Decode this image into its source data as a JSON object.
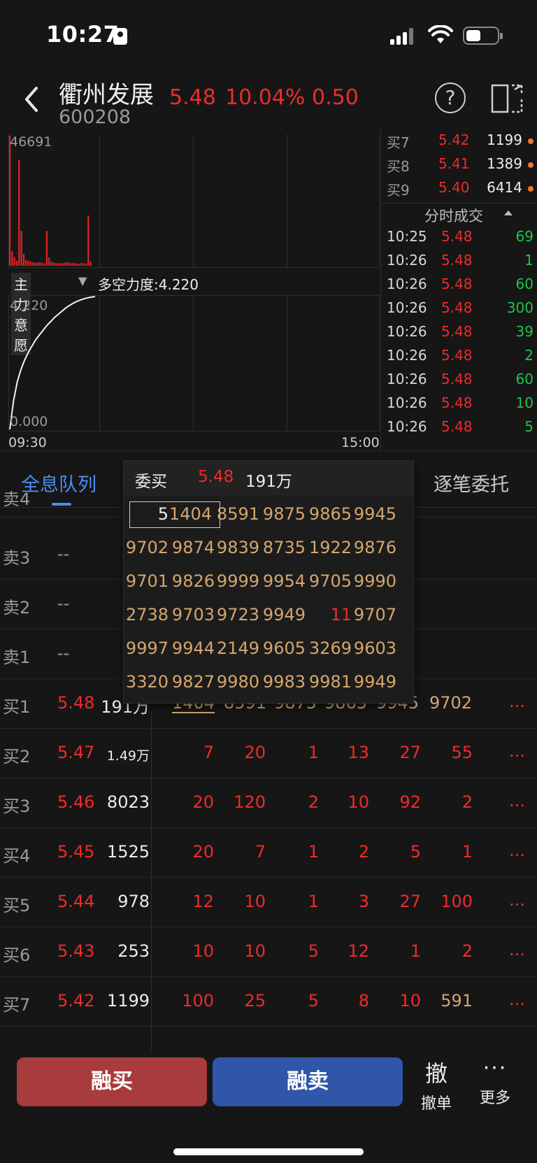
{
  "status_bar": {
    "time": "10:27"
  },
  "header": {
    "stock_name": "衢州发展",
    "stock_code": "600208",
    "price": "5.48",
    "change_pct": "10.04%",
    "change": "0.50",
    "help_glyph": "?"
  },
  "charts": {
    "volume_max": "46691",
    "indicator_name": "主力意愿",
    "indicator_value": "多空力度:4.220",
    "line_max": "4.220",
    "line_min": "0.000",
    "time_start": "09:30",
    "time_end": "15:00"
  },
  "bid_book_top": [
    {
      "label": "买7",
      "price": "5.42",
      "volume": "1199"
    },
    {
      "label": "买8",
      "price": "5.41",
      "volume": "1389"
    },
    {
      "label": "买9",
      "price": "5.40",
      "volume": "6414"
    }
  ],
  "ticks": {
    "title": "分时成交",
    "rows": [
      {
        "time": "10:25",
        "price": "5.48",
        "volume": "69"
      },
      {
        "time": "10:26",
        "price": "5.48",
        "volume": "1"
      },
      {
        "time": "10:26",
        "price": "5.48",
        "volume": "60"
      },
      {
        "time": "10:26",
        "price": "5.48",
        "volume": "300"
      },
      {
        "time": "10:26",
        "price": "5.48",
        "volume": "39"
      },
      {
        "time": "10:26",
        "price": "5.48",
        "volume": "2"
      },
      {
        "time": "10:26",
        "price": "5.48",
        "volume": "60"
      },
      {
        "time": "10:26",
        "price": "5.48",
        "volume": "10"
      },
      {
        "time": "10:26",
        "price": "5.48",
        "volume": "5"
      }
    ]
  },
  "tabs": {
    "full_queue": "全息队列",
    "order_by_order": "逐笔委托"
  },
  "order_table": {
    "partial_top_label": "卖4",
    "sell_rows": [
      {
        "label": "卖3",
        "value": "--"
      },
      {
        "label": "卖2",
        "value": "--"
      },
      {
        "label": "卖1",
        "value": "--"
      }
    ],
    "buy_rows": [
      {
        "label": "买1",
        "price": "5.48",
        "volume": "191万",
        "queue": [
          "1404",
          "8591",
          "9875",
          "9865",
          "9945",
          "9702"
        ],
        "more": "..."
      },
      {
        "label": "买2",
        "price": "5.47",
        "volume": "1.49万",
        "queue": [
          "7",
          "20",
          "1",
          "13",
          "27",
          "55"
        ],
        "more": "..."
      },
      {
        "label": "买3",
        "price": "5.46",
        "volume": "8023",
        "queue": [
          "20",
          "120",
          "2",
          "10",
          "92",
          "2"
        ],
        "more": "..."
      },
      {
        "label": "买4",
        "price": "5.45",
        "volume": "1525",
        "queue": [
          "20",
          "7",
          "1",
          "2",
          "5",
          "1"
        ],
        "more": "..."
      },
      {
        "label": "买5",
        "price": "5.44",
        "volume": "978",
        "queue": [
          "12",
          "10",
          "1",
          "3",
          "27",
          "100"
        ],
        "more": "..."
      },
      {
        "label": "买6",
        "price": "5.43",
        "volume": "253",
        "queue": [
          "10",
          "10",
          "5",
          "12",
          "1",
          "2"
        ],
        "more": "..."
      },
      {
        "label": "买7",
        "price": "5.42",
        "volume": "1199",
        "queue": [
          "100",
          "25",
          "5",
          "8",
          "10",
          "591"
        ],
        "more": "..."
      }
    ]
  },
  "popup": {
    "title": "委买",
    "price": "5.48",
    "volume": "191万",
    "selected_index": "5",
    "rows": [
      [
        "1404",
        "8591",
        "9875",
        "9865",
        "9945"
      ],
      [
        "9702",
        "9874",
        "9839",
        "8735",
        "1922",
        "9876"
      ],
      [
        "9701",
        "9826",
        "9999",
        "9954",
        "9705",
        "9990"
      ],
      [
        "2738",
        "9703",
        "9723",
        "9949",
        "11",
        "9707"
      ],
      [
        "9997",
        "9944",
        "2149",
        "9605",
        "3269",
        "9603"
      ],
      [
        "3320",
        "9827",
        "9980",
        "9983",
        "9981",
        "9949"
      ]
    ]
  },
  "bottom_bar": {
    "margin_buy": "融买",
    "margin_sell": "融卖",
    "cancel_icon": "撤",
    "cancel_label": "撤单",
    "more_icon": "···",
    "more_label": "更多"
  },
  "colors": {
    "up": "#ee2b2b",
    "down": "#20c24b",
    "queue": "#d4a66e",
    "accent": "#4b8df0"
  },
  "chart_data": [
    {
      "type": "bar",
      "title": "",
      "series": [
        {
          "values": [
            46691,
            5200,
            3100,
            1800,
            38000,
            12500,
            4200,
            2100,
            1700,
            1500,
            1300,
            1100,
            1200,
            1300,
            1000,
            900,
            12500,
            3000,
            1500,
            1100,
            1000,
            900,
            950,
            850,
            1200,
            1400,
            1000,
            900,
            1100,
            800,
            700,
            1000,
            900,
            800,
            18000,
            1500
          ]
        }
      ],
      "ylim": [
        0,
        46691
      ]
    },
    {
      "type": "line",
      "title": "",
      "series": [
        {
          "values": [
            0.0,
            0.9,
            1.5,
            1.9,
            2.2,
            2.45,
            2.65,
            2.85,
            3.0,
            3.15,
            3.3,
            3.42,
            3.55,
            3.65,
            3.75,
            3.85,
            3.93,
            4.0,
            4.06,
            4.11,
            4.15,
            4.18,
            4.2,
            4.22
          ]
        }
      ],
      "ylim": [
        0,
        4.22
      ],
      "x_range": [
        "09:30",
        "15:00"
      ]
    }
  ]
}
